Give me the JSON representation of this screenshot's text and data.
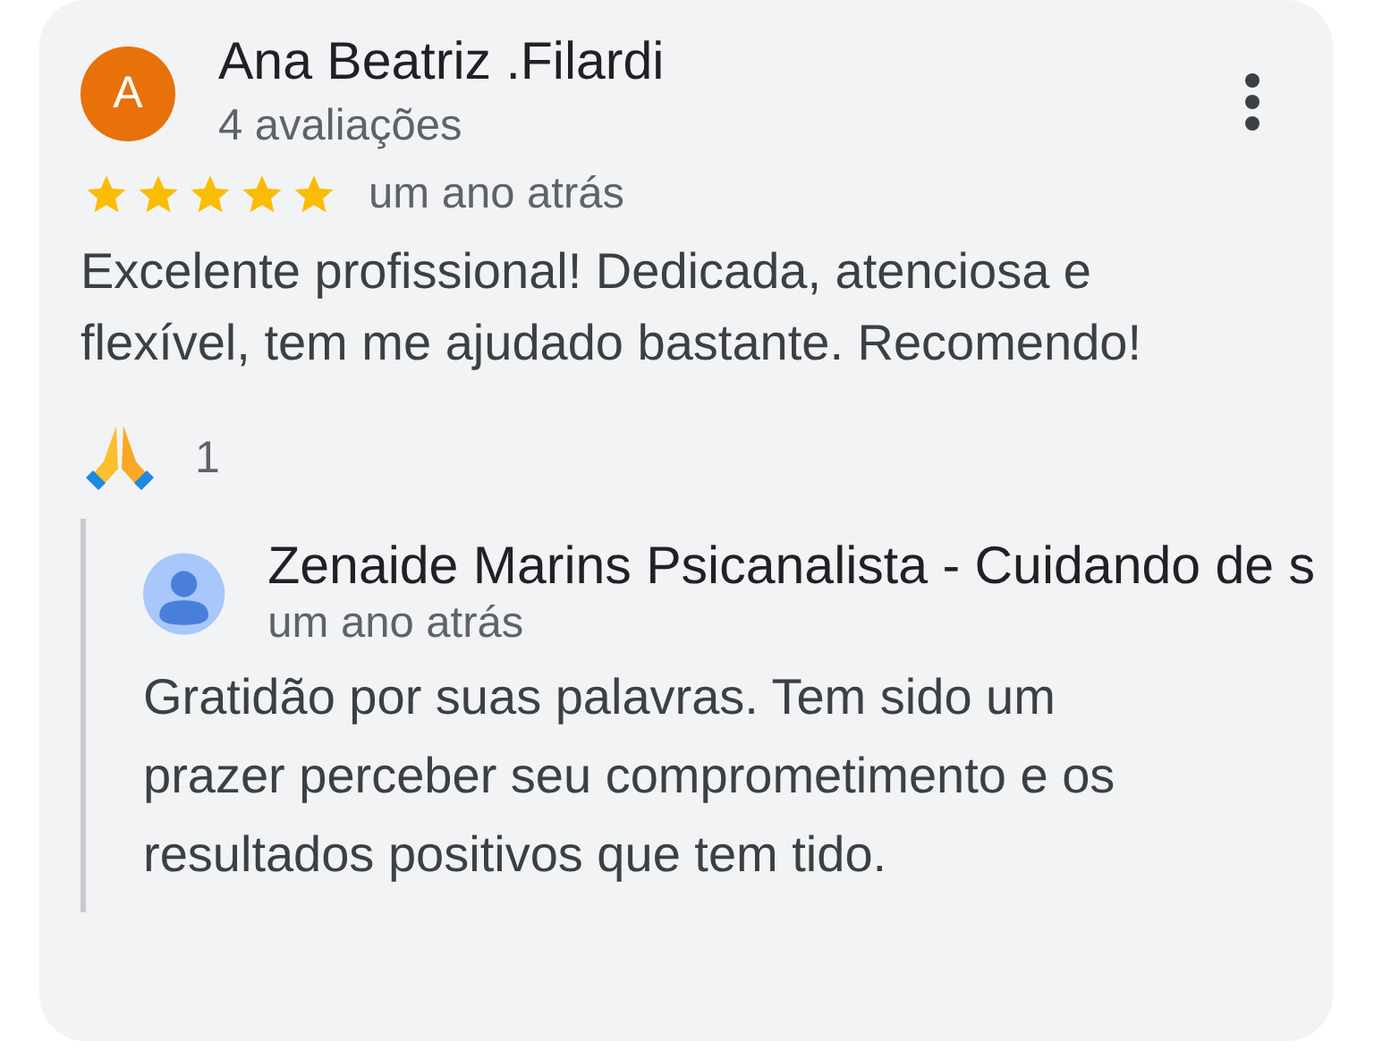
{
  "review": {
    "avatar_letter": "A",
    "author": "Ana Beatriz .Filardi",
    "review_count": "4 avaliações",
    "stars": 5,
    "time": "um ano atrás",
    "text": "Excelente profissional! Dedicada, atenciosa e flexível, tem me ajudado bastante. Recomendo!",
    "reaction_count": "1"
  },
  "reply": {
    "author": "Zenaide Marins Psicanalista - Cuidando de s",
    "time": "um ano atrás",
    "text": "Gratidão por suas palavras. Tem sido um prazer perceber seu comprometimento e os resultados positivos que tem tido."
  }
}
